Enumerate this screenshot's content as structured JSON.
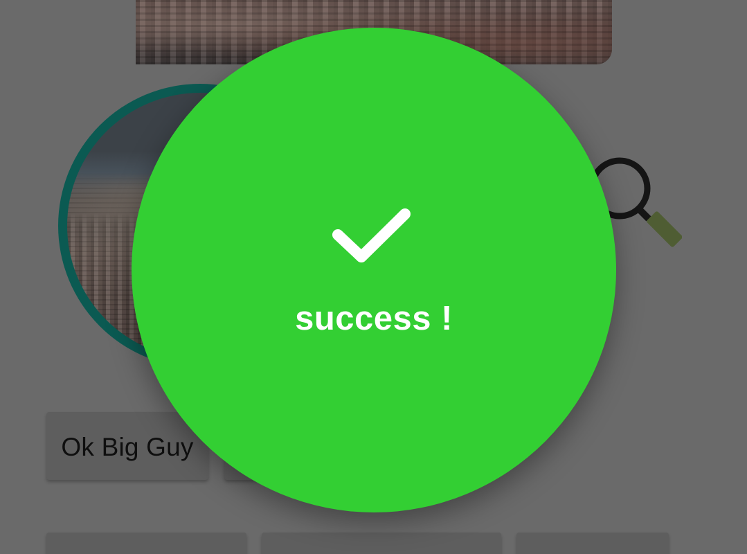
{
  "background_screen": {
    "ok_button_label": "Ok Big Guy",
    "icons": {
      "search": "search-icon"
    }
  },
  "success_dialog": {
    "message": "success !",
    "icon": "checkmark-icon",
    "color": "#33cf33"
  },
  "colors": {
    "scrim": "#6a6a6a",
    "avatar_ring": "#0b5a52",
    "success_green": "#33cf33",
    "check_white": "#ffffff"
  }
}
